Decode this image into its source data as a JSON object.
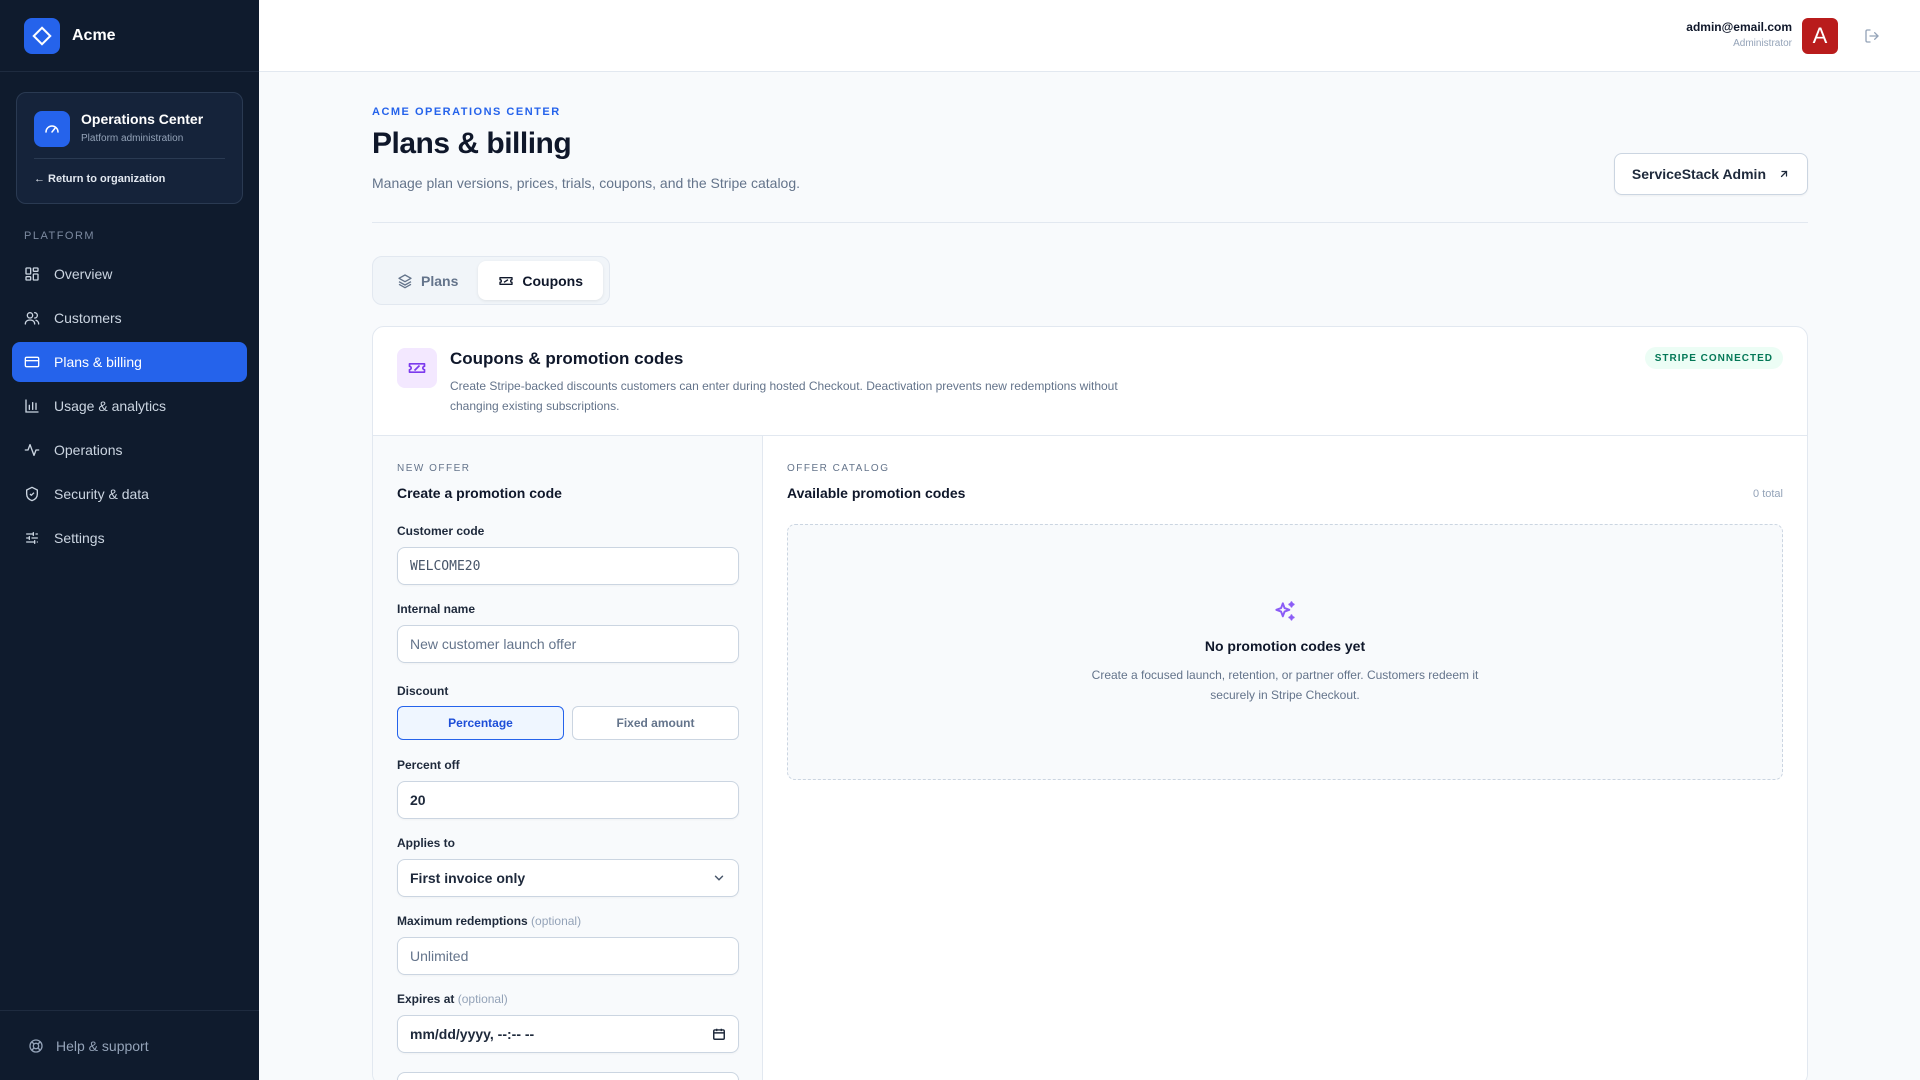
{
  "brand": {
    "name": "Acme"
  },
  "ops_card": {
    "title": "Operations Center",
    "subtitle": "Platform administration",
    "return_label": "← Return to organization"
  },
  "sidebar": {
    "section_label": "PLATFORM",
    "items": [
      {
        "label": "Overview",
        "icon": "grid-icon",
        "active": false
      },
      {
        "label": "Customers",
        "icon": "users-icon",
        "active": false
      },
      {
        "label": "Plans & billing",
        "icon": "credit-card-icon",
        "active": true
      },
      {
        "label": "Usage & analytics",
        "icon": "bar-chart-icon",
        "active": false
      },
      {
        "label": "Operations",
        "icon": "activity-icon",
        "active": false
      },
      {
        "label": "Security & data",
        "icon": "shield-icon",
        "active": false
      },
      {
        "label": "Settings",
        "icon": "sliders-icon",
        "active": false
      }
    ],
    "help_label": "Help & support"
  },
  "topbar": {
    "user_email": "admin@email.com",
    "user_role": "Administrator",
    "avatar_letter": "A"
  },
  "header": {
    "eyebrow": "ACME OPERATIONS CENTER",
    "title": "Plans & billing",
    "description": "Manage plan versions, prices, trials, coupons, and the Stripe catalog.",
    "admin_button": "ServiceStack Admin"
  },
  "tabs": [
    {
      "label": "Plans",
      "icon": "layers-icon",
      "active": false
    },
    {
      "label": "Coupons",
      "icon": "ticket-icon",
      "active": true
    }
  ],
  "card": {
    "title": "Coupons & promotion codes",
    "description": "Create Stripe-backed discounts customers can enter during hosted Checkout. Deactivation prevents new redemptions without changing existing subscriptions.",
    "badge": "STRIPE CONNECTED"
  },
  "form": {
    "eyebrow": "NEW OFFER",
    "title": "Create a promotion code",
    "customer_code": {
      "label": "Customer code",
      "placeholder": "WELCOME20"
    },
    "internal_name": {
      "label": "Internal name",
      "placeholder": "New customer launch offer"
    },
    "discount": {
      "label": "Discount",
      "options": [
        "Percentage",
        "Fixed amount"
      ],
      "selected": "Percentage"
    },
    "percent_off": {
      "label": "Percent off",
      "value": "20"
    },
    "applies_to": {
      "label": "Applies to",
      "value": "First invoice only"
    },
    "max_redemptions": {
      "label": "Maximum redemptions",
      "optional": "(optional)",
      "placeholder": "Unlimited"
    },
    "expires_at": {
      "label": "Expires at",
      "optional": "(optional)",
      "placeholder": "mm/dd/yyyy, --:-- --"
    }
  },
  "catalog": {
    "eyebrow": "OFFER CATALOG",
    "title": "Available promotion codes",
    "count": "0 total",
    "empty_title": "No promotion codes yet",
    "empty_desc": "Create a focused launch, retention, or partner offer. Customers redeem it securely in Stripe Checkout."
  },
  "colors": {
    "sidebar_bg": "#0f1b2d",
    "accent": "#2563eb",
    "avatar": "#b91c1c",
    "success": "#047857",
    "purple": "#7c3aed"
  }
}
